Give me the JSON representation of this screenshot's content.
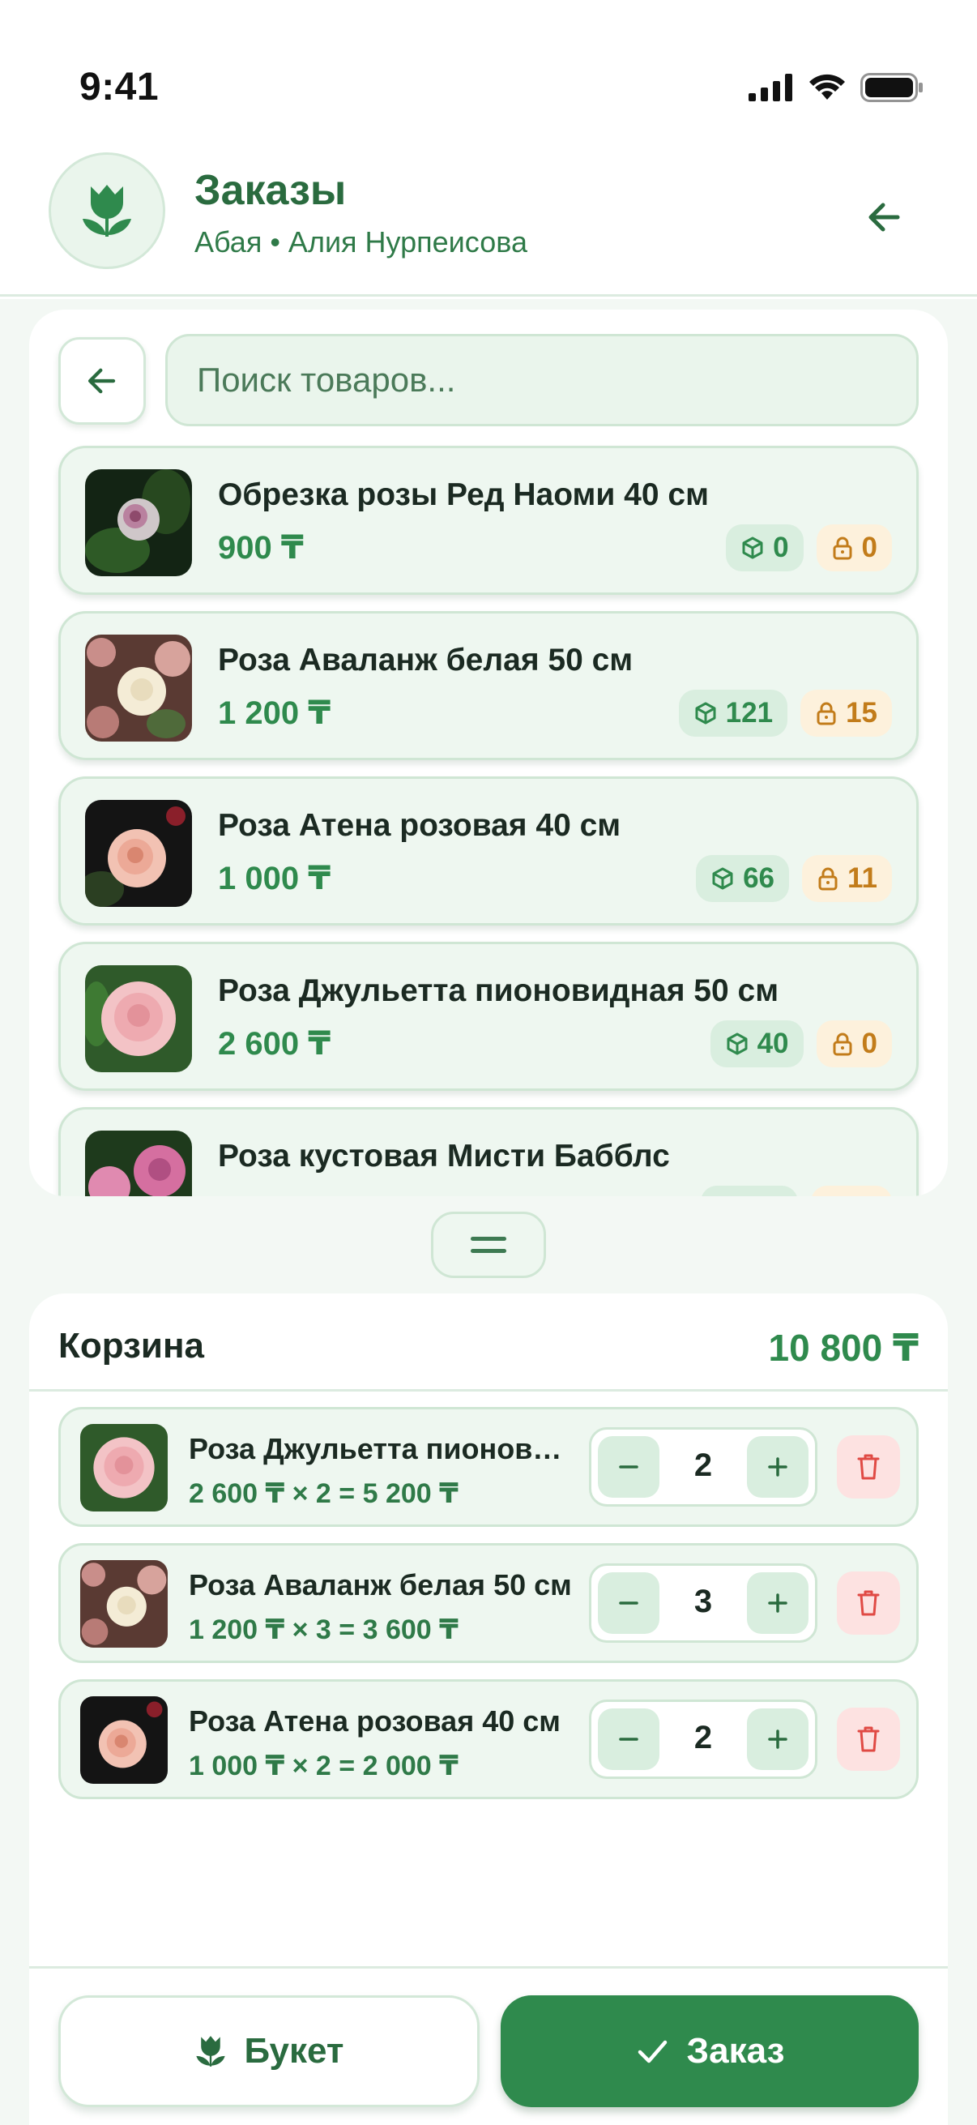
{
  "status_bar": {
    "time": "9:41"
  },
  "header": {
    "title": "Заказы",
    "subtitle": "Абая • Алия Нурпеисова"
  },
  "search": {
    "placeholder": "Поиск товаров..."
  },
  "products": [
    {
      "name": "Обрезка розы Ред Наоми 40 см",
      "price": "900 ₸",
      "stock": "0",
      "reserved": "0"
    },
    {
      "name": "Роза Аваланж белая 50 см",
      "price": "1 200 ₸",
      "stock": "121",
      "reserved": "15"
    },
    {
      "name": "Роза Атена розовая 40 см",
      "price": "1 000 ₸",
      "stock": "66",
      "reserved": "11"
    },
    {
      "name": "Роза Джульетта пионовидная 50 см",
      "price": "2 600 ₸",
      "stock": "40",
      "reserved": "0"
    },
    {
      "name": "Роза кустовая Мисти Бабблс",
      "price": "",
      "stock": "",
      "reserved": ""
    }
  ],
  "cart": {
    "title": "Корзина",
    "total": "10 800 ₸",
    "items": [
      {
        "name": "Роза Джульетта пионовидная 50 см",
        "calc": "2 600 ₸ × 2 = 5 200 ₸",
        "qty": "2"
      },
      {
        "name": "Роза Аваланж белая 50 см",
        "calc": "1 200 ₸ × 3 = 3 600 ₸",
        "qty": "3"
      },
      {
        "name": "Роза Атена розовая 40 см",
        "calc": "1 000 ₸ × 2 = 2 000 ₸",
        "qty": "2"
      }
    ]
  },
  "actions": {
    "bouquet_label": "Букет",
    "order_label": "Заказ"
  },
  "colors": {
    "brand": "#2f8a4d",
    "brand_dark": "#2a6b3f",
    "card_bg": "#eef7f0",
    "reserve_accent": "#c27c1a",
    "danger": "#e04a44"
  },
  "icons": [
    "tulip-icon",
    "arrow-left-icon",
    "box-icon",
    "lock-icon",
    "drag-handle-icon",
    "minus-icon",
    "plus-icon",
    "trash-icon",
    "check-icon"
  ]
}
